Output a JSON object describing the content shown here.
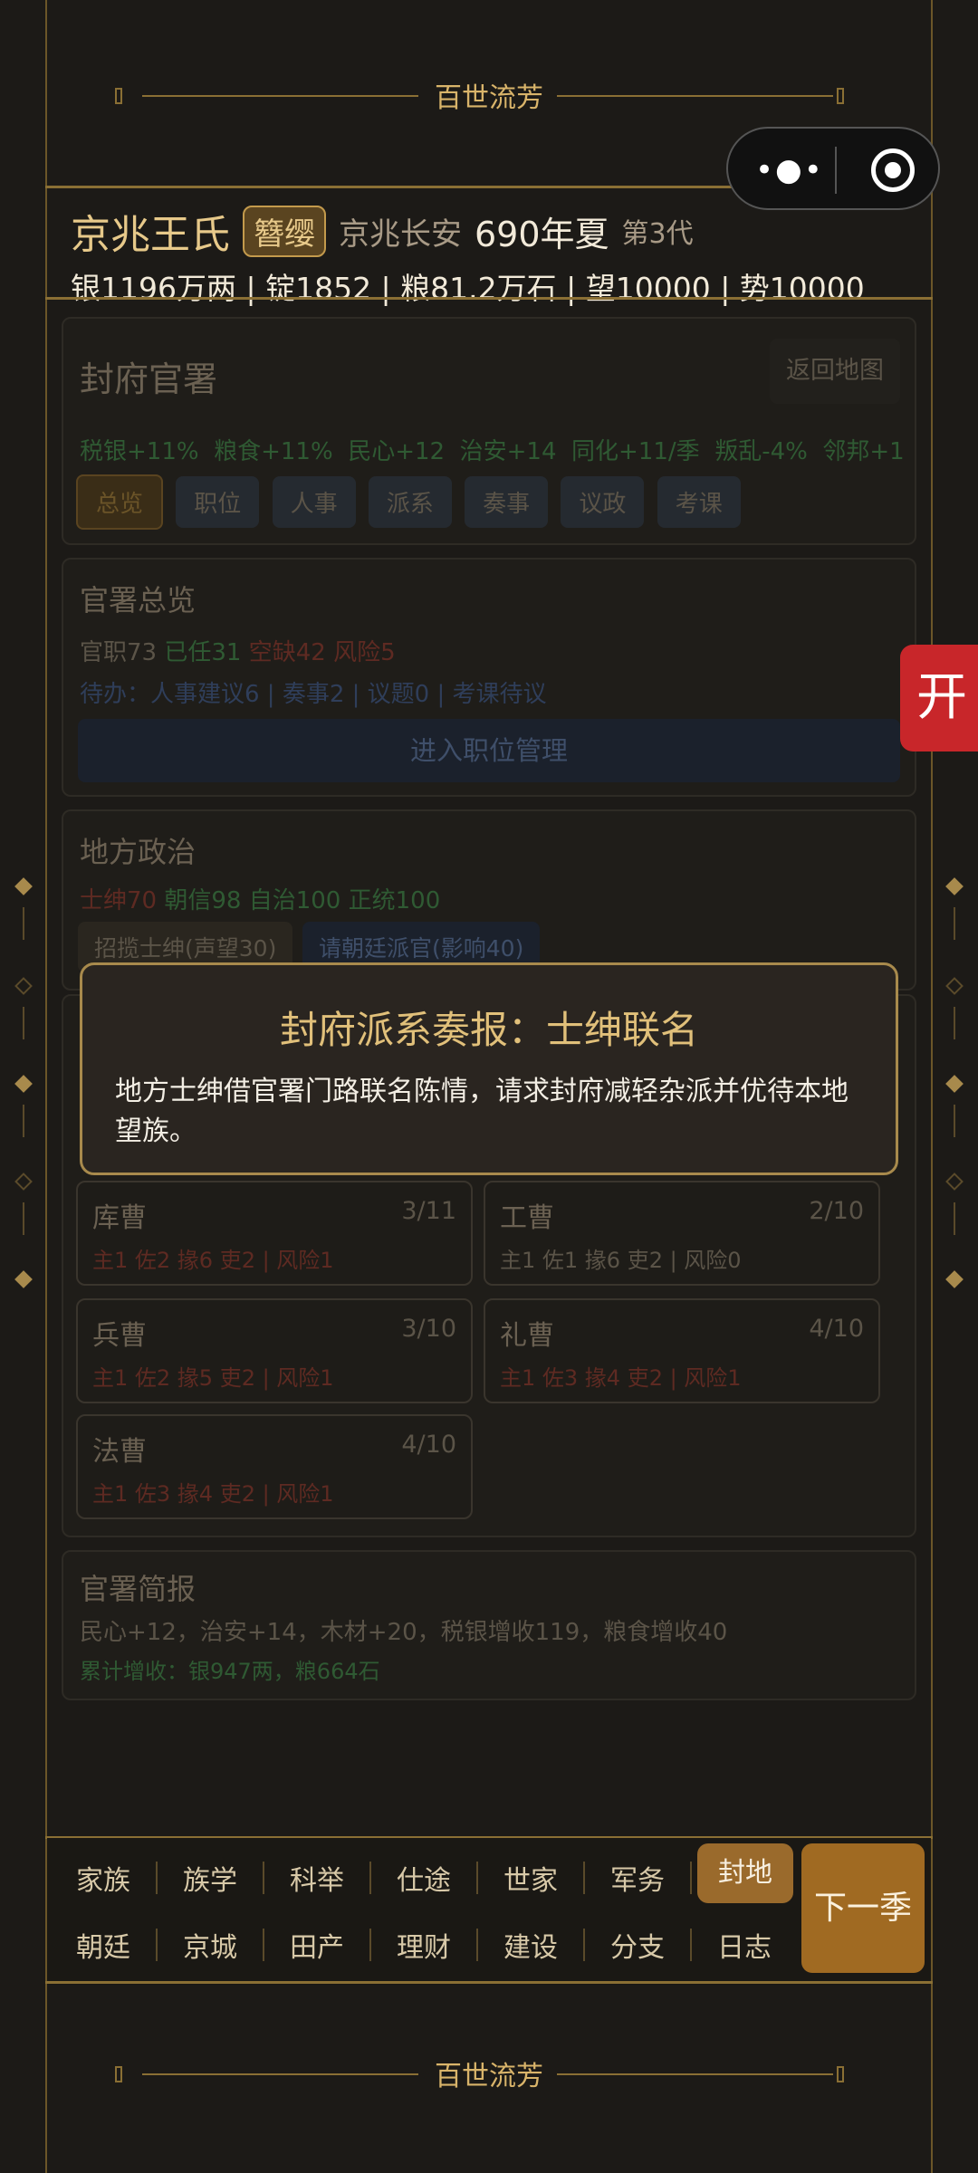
{
  "banner_title": "百世流芳",
  "header": {
    "clan": "京兆王氏",
    "rank_tag": "簪缨",
    "location": "京兆长安",
    "year": "690年夏",
    "generation": "第3代",
    "resources": "银1196万两 | 锭1852 | 粮81.2万石 | 望10000 | 势10000"
  },
  "fief": {
    "title": "封府官署",
    "back_button": "返回地图",
    "effects": [
      "税银+11%",
      "粮食+11%",
      "民心+12",
      "治安+14",
      "同化+11/季",
      "叛乱-4%",
      "邻邦+1"
    ],
    "tabs": [
      "总览",
      "职位",
      "人事",
      "派系",
      "奏事",
      "议政",
      "考课"
    ]
  },
  "overview": {
    "title": "官署总览",
    "total": "官职73",
    "filled": "已任31",
    "vacant": "空缺42",
    "risk": "风险5",
    "todo": "待办：人事建议6 | 奏事2 | 议题0 | 考课待议",
    "enter_button": "进入职位管理"
  },
  "local": {
    "title": "地方政治",
    "gentry": "士绅70",
    "trust": "朝信98",
    "autonomy": "自治100",
    "legit": "正统100",
    "btn_recruit": "招揽士绅(声望30)",
    "btn_request": "请朝廷派官(影响40)"
  },
  "bureaus": [
    {
      "name": "库曹",
      "count": "3/11",
      "detail": "主1 佐2 掾6 吏2 | 风险1",
      "risk": true
    },
    {
      "name": "工曹",
      "count": "2/10",
      "detail": "主1 佐1 掾6 吏2 | 风险0",
      "risk": false
    },
    {
      "name": "兵曹",
      "count": "3/10",
      "detail": "主1 佐2 掾5 吏2 | 风险1",
      "risk": true
    },
    {
      "name": "礼曹",
      "count": "4/10",
      "detail": "主1 佐3 掾4 吏2 | 风险1",
      "risk": true
    },
    {
      "name": "法曹",
      "count": "4/10",
      "detail": "主1 佐3 掾4 吏2 | 风险1",
      "risk": true
    }
  ],
  "brief": {
    "title": "官署简报",
    "line1": "民心+12，治安+14，木材+20，税银增收119，粮食增收40",
    "line2": "累计增收：银947两，粮664石"
  },
  "modal": {
    "title": "封府派系奏报：士绅联名",
    "body": "地方士绅借官署门路联名陈情，请求封府减轻杂派并优待本地望族。"
  },
  "side_button": "开",
  "nav": {
    "row1": [
      "家族",
      "族学",
      "科举",
      "仕途",
      "世家",
      "军务",
      "封地"
    ],
    "row2": [
      "朝廷",
      "京城",
      "田产",
      "理财",
      "建设",
      "分支",
      "日志"
    ],
    "active": "封地",
    "next": "下一季"
  }
}
